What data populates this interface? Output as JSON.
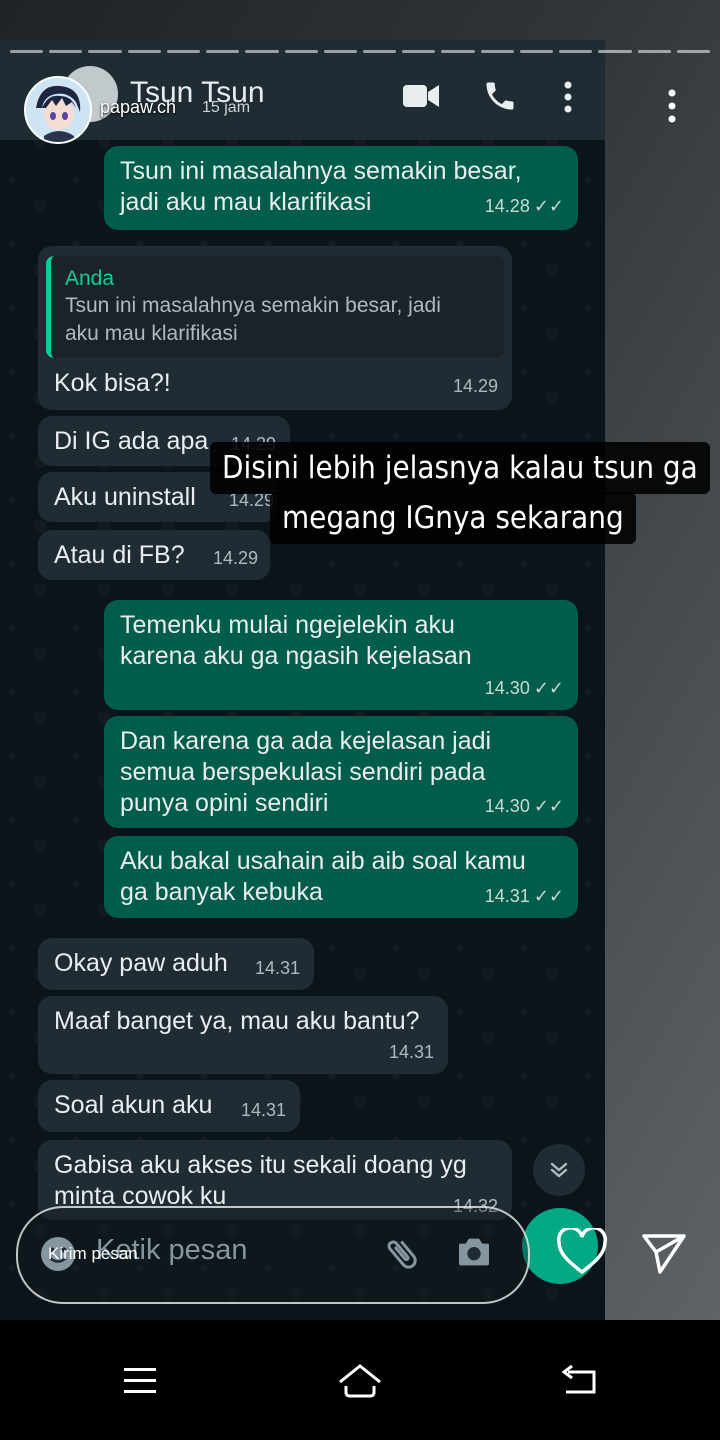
{
  "story": {
    "username": "papaw.ch",
    "time_ago": "15 jam",
    "overlay_text_line1": "Disini lebih jelasnya kalau tsun ga",
    "overlay_text_line2": "megang IGnya sekarang",
    "reply_placeholder": "Kirim pesan"
  },
  "chat": {
    "contact_name": "Tsun Tsun",
    "input_placeholder": "Ketik pesan",
    "messages": [
      {
        "dir": "out",
        "line1": "Tsun ini masalahnya semakin besar,",
        "line2": "jadi aku mau klarifikasi",
        "time": "14.28"
      },
      {
        "dir": "in",
        "quote_name": "Anda",
        "quote_line1": "Tsun ini masalahnya semakin besar, jadi",
        "quote_line2": "aku mau klarifikasi",
        "text": "Kok bisa?!",
        "time": "14.29"
      },
      {
        "dir": "in",
        "text": "Di IG ada apa",
        "time": "14.29"
      },
      {
        "dir": "in",
        "text": "Aku uninstall",
        "time": "14.29"
      },
      {
        "dir": "in",
        "text": "Atau di FB?",
        "time": "14.29"
      },
      {
        "dir": "out",
        "line1": "Temenku mulai ngejelekin aku",
        "line2": "karena aku ga ngasih kejelasan",
        "time": "14.30"
      },
      {
        "dir": "out",
        "line1": "Dan karena ga ada kejelasan jadi",
        "line2": "semua berspekulasi sendiri pada",
        "line3": "punya opini sendiri",
        "time": "14.30"
      },
      {
        "dir": "out",
        "line1": "Aku bakal usahain aib aib soal kamu",
        "line2": "ga banyak kebuka",
        "time": "14.31"
      },
      {
        "dir": "in",
        "text": "Okay paw aduh",
        "time": "14.31"
      },
      {
        "dir": "in",
        "text": "Maaf banget ya, mau aku bantu?",
        "time": "14.31"
      },
      {
        "dir": "in",
        "text": "Soal akun aku",
        "time": "14.31"
      },
      {
        "dir": "in",
        "line1": "Gabisa aku akses itu sekali doang yg",
        "line2": "minta cowok ku",
        "time": "14.32"
      }
    ]
  },
  "colors": {
    "chat_bg": "#0b141a",
    "incoming_bubble": "#202c33",
    "outgoing_bubble": "#005c4b",
    "accent": "#00a884"
  },
  "icons": [
    "video-call-icon",
    "voice-call-icon",
    "menu-dots-icon",
    "double-check-icon",
    "chevron-down-icon",
    "emoji-icon",
    "attach-icon",
    "camera-icon",
    "mic-icon",
    "heart-icon",
    "send-icon",
    "nav-menu-icon",
    "nav-home-icon",
    "nav-back-icon"
  ]
}
